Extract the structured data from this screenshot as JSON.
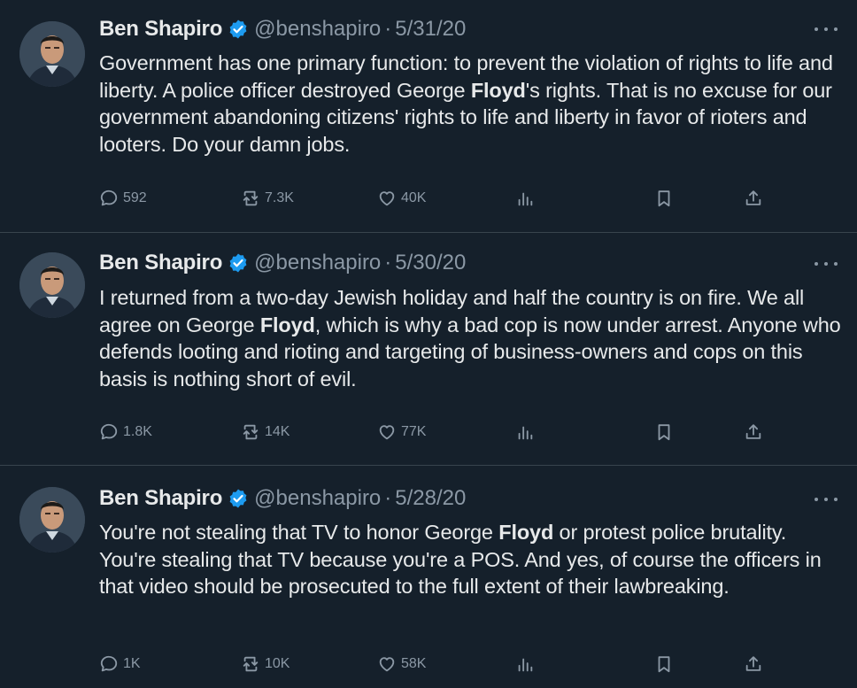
{
  "tweets": [
    {
      "name": "Ben Shapiro",
      "handle": "@benshapiro",
      "separator": "·",
      "date": "5/31/20",
      "text": {
        "part1": "Government has one primary function: to prevent the violation of rights to life and liberty. A police officer destroyed George ",
        "bold": "Floyd",
        "part2": "'s rights. That is no excuse for our government abandoning citizens' rights to life and liberty in favor of rioters and looters. Do your damn jobs."
      },
      "replies": "592",
      "retweets": "7.3K",
      "likes": "40K"
    },
    {
      "name": "Ben Shapiro",
      "handle": "@benshapiro",
      "separator": "·",
      "date": "5/30/20",
      "text": {
        "part1": "I returned from a two-day Jewish holiday and half the country is on fire. We all agree on George ",
        "bold": "Floyd",
        "part2": ", which is why a bad cop is now under arrest. Anyone who defends looting and rioting and targeting of business-owners and cops on this basis is nothing short of evil."
      },
      "replies": "1.8K",
      "retweets": "14K",
      "likes": "77K"
    },
    {
      "name": "Ben Shapiro",
      "handle": "@benshapiro",
      "separator": "·",
      "date": "5/28/20",
      "text": {
        "part1": "You're not stealing that TV to honor George ",
        "bold": "Floyd",
        "part2": " or protest police brutality. You're stealing that TV because you're a POS. And yes, of course the officers in that video should be prosecuted to the full extent of their lawbreaking."
      },
      "replies": "1K",
      "retweets": "10K",
      "likes": "58K"
    }
  ],
  "icons": {
    "reply": "reply-icon",
    "retweet": "retweet-icon",
    "like": "heart-icon",
    "views": "views-icon",
    "bookmark": "bookmark-icon",
    "share": "share-icon",
    "verified": "verified-badge-icon",
    "more": "more-icon"
  },
  "colors": {
    "background": "#15202b",
    "text": "#e7e9ea",
    "muted": "#8b98a5",
    "verified": "#1d9bf0",
    "divider": "#38444d"
  }
}
